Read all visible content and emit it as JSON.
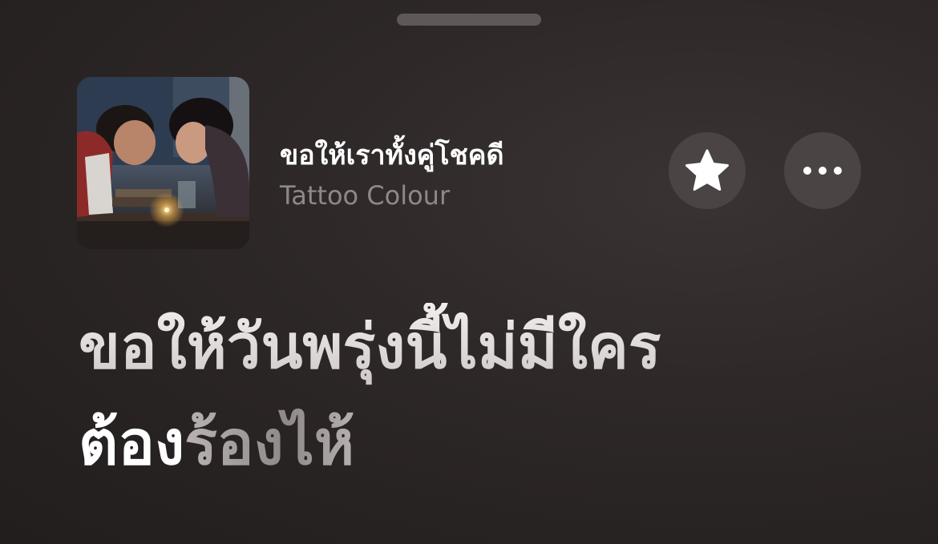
{
  "now_playing": {
    "title": "ขอให้เราทั้งคู่โชคดี",
    "artist": "Tattoo Colour",
    "artwork_icon": "album-artwork"
  },
  "actions": {
    "favorite_icon": "star-icon",
    "more_icon": "ellipsis-icon"
  },
  "lyrics": {
    "line1": "ขอให้วันพรุ่งนี้ไม่มีใคร",
    "line2_sung": "ต้อง",
    "line2_unsung": "ร้องไห้"
  },
  "colors": {
    "background": "#2b2626",
    "button": "#4a4444",
    "grabber": "#5e5858",
    "artist_text": "#8e8888"
  }
}
